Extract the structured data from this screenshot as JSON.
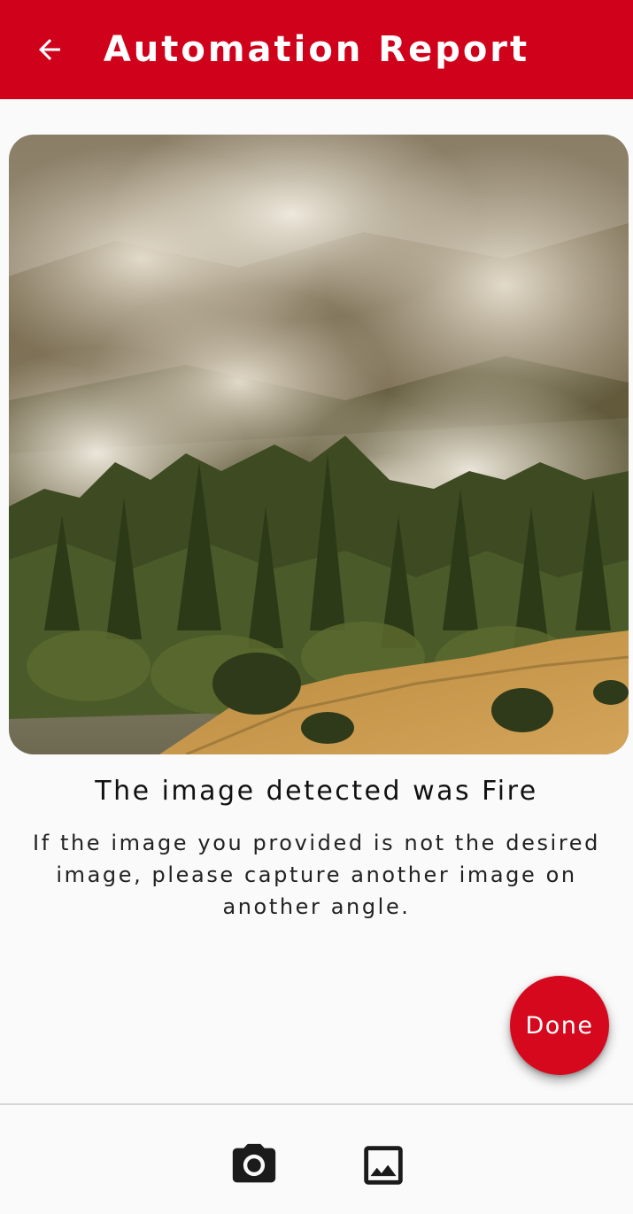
{
  "app_bar": {
    "title": "Automation Report",
    "back_icon": "arrow-left-icon",
    "background": "#d0011b"
  },
  "result": {
    "title": "The image detected was Fire",
    "description": "If the image you provided is not the desired image, please capture another image on another angle."
  },
  "fab": {
    "label": "Done",
    "color": "#d6081e"
  },
  "bottom_nav": {
    "items": [
      {
        "icon": "camera-icon"
      },
      {
        "icon": "image-gallery-icon"
      }
    ]
  }
}
